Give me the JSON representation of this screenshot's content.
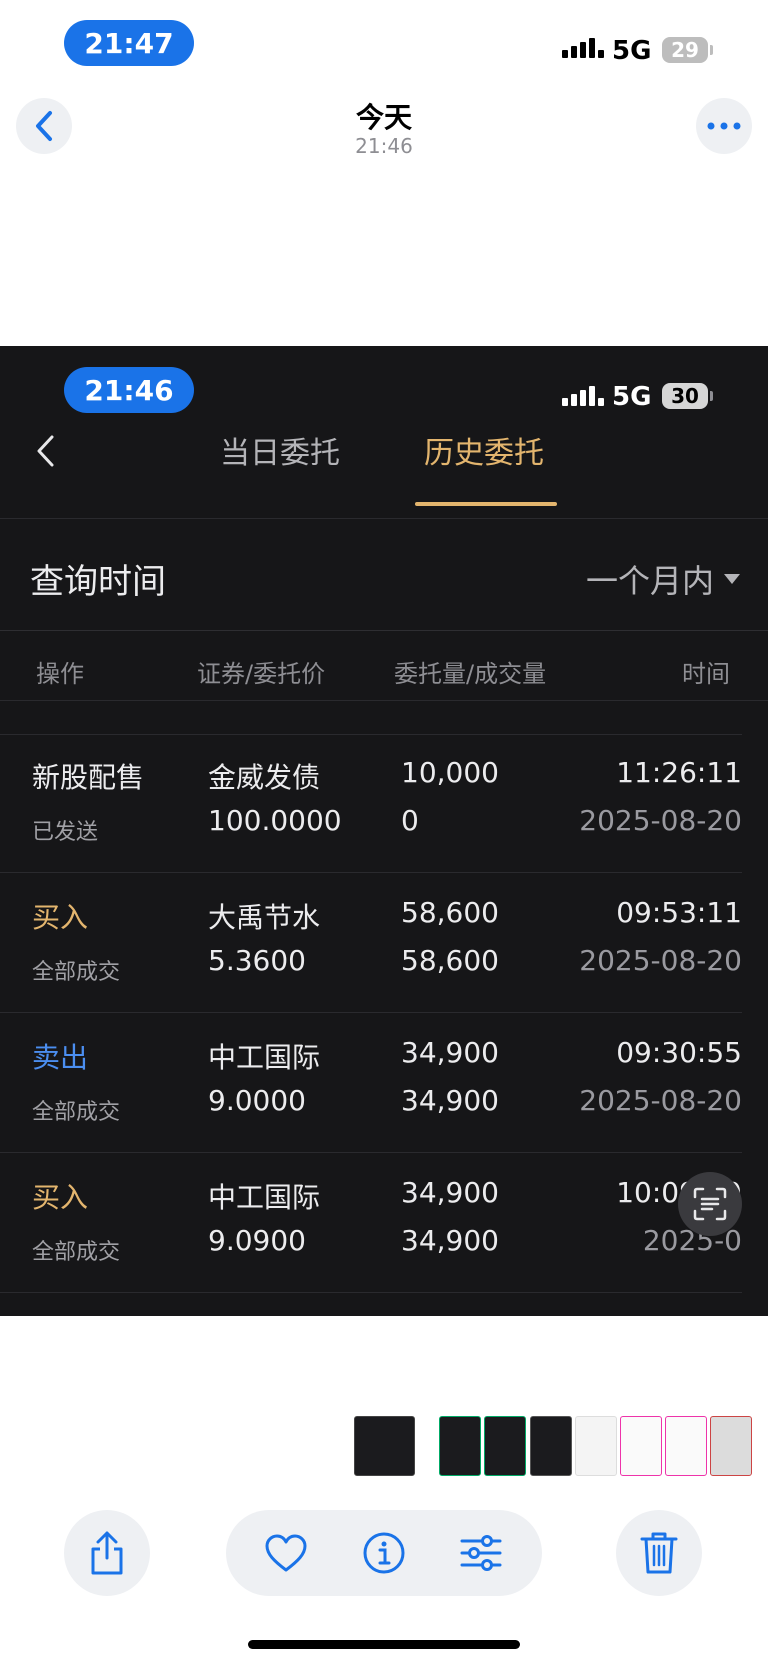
{
  "outer_status": {
    "time": "21:47",
    "network": "5G",
    "battery": "29"
  },
  "viewer": {
    "title": "今天",
    "subtitle": "21:46"
  },
  "inner_status": {
    "time": "21:46",
    "network": "5G",
    "battery": "30"
  },
  "tabs": [
    {
      "label": "当日委托",
      "active": false
    },
    {
      "label": "历史委托",
      "active": true
    }
  ],
  "query": {
    "label": "查询时间",
    "range": "一个月内"
  },
  "columns": [
    "操作",
    "证券/委托价",
    "委托量/成交量",
    "时间"
  ],
  "orders": [
    {
      "action": "新股配售",
      "action_color": "#ececee",
      "status": "已发送",
      "security": "金威发债",
      "price": "100.0000",
      "qty": "10,000",
      "filled": "0",
      "time": "11:26:11",
      "date": "2025-08-20"
    },
    {
      "action": "买入",
      "action_color": "#e3b56e",
      "status": "全部成交",
      "security": "大禹节水",
      "price": "5.3600",
      "qty": "58,600",
      "filled": "58,600",
      "time": "09:53:11",
      "date": "2025-08-20"
    },
    {
      "action": "卖出",
      "action_color": "#4b8ef0",
      "status": "全部成交",
      "security": "中工国际",
      "price": "9.0000",
      "qty": "34,900",
      "filled": "34,900",
      "time": "09:30:55",
      "date": "2025-08-20"
    },
    {
      "action": "买入",
      "action_color": "#e3b56e",
      "status": "全部成交",
      "security": "中工国际",
      "price": "9.0900",
      "qty": "34,900",
      "filled": "34,900",
      "time": "10:09:39",
      "date": "2025-0"
    }
  ],
  "colors": {
    "accent_blue": "#1a73e8",
    "gold": "#e3b56e",
    "sell_blue": "#4b8ef0",
    "dark_bg": "#161618"
  },
  "icons": [
    "back-chevron-icon",
    "more-icon",
    "share-icon",
    "heart-icon",
    "info-icon",
    "adjust-icon",
    "trash-icon",
    "live-text-icon"
  ]
}
